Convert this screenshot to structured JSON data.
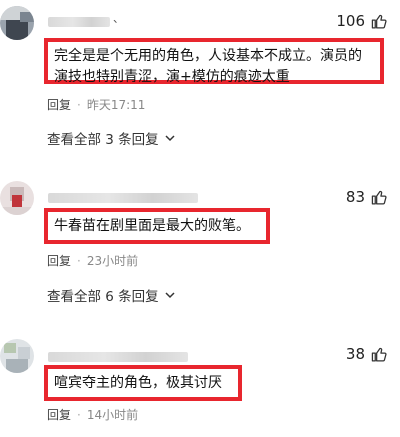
{
  "comments": [
    {
      "likes": "106",
      "text": "完全是是个无用的角色，人设基本不成立。演员的演技也特别青涩，演+模仿的痕迹太重",
      "reply_label": "回复",
      "time": "昨天17:11",
      "view_all": "查看全部 3 条回复",
      "name_tail": "、"
    },
    {
      "likes": "83",
      "text": "牛春苗在剧里面是最大的败笔。",
      "reply_label": "回复",
      "time": "23小时前",
      "view_all": "查看全部 6 条回复"
    },
    {
      "likes": "38",
      "text": "喧宾夺主的角色，极其讨厌",
      "reply_label": "回复",
      "time": "14小时前"
    }
  ],
  "icons": {
    "like": "thumbs-up-icon",
    "expand": "chevron-down-icon"
  },
  "colors": {
    "highlight_border": "#e8262e"
  }
}
